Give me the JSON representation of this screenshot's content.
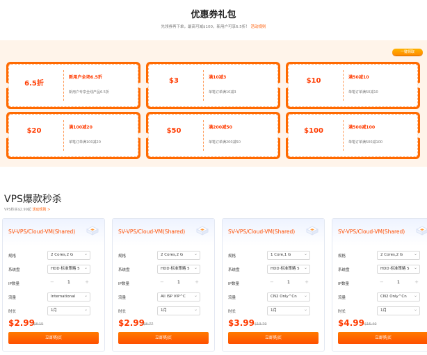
{
  "hero": {
    "title": "优惠券礼包",
    "subtitle": "先领券再下单，最高可减$100，新用户可享6.5折！",
    "rules_link": "活动规则"
  },
  "coupon_area": {
    "pill_label": "一键领取",
    "coupons": [
      {
        "amount": "6.5折",
        "title": "新用户全场6.5折",
        "desc": "新用户专享全线产品6.5折"
      },
      {
        "amount": "$3",
        "title": "满10减3",
        "desc": "单笔订单满10减3"
      },
      {
        "amount": "$10",
        "title": "满50减10",
        "desc": "单笔订单满50减10"
      },
      {
        "amount": "$20",
        "title": "满100减20",
        "desc": "单笔订单满100减20"
      },
      {
        "amount": "$50",
        "title": "满200减50",
        "desc": "单笔订单满200减50"
      },
      {
        "amount": "$100",
        "title": "满500减100",
        "desc": "单笔订单满500减100"
      }
    ]
  },
  "vps_section": {
    "title": "VPS爆款秒杀",
    "subtitle": "VPS秒杀$2.99起",
    "rules_link": "活动规则 >"
  },
  "cards": [
    {
      "name": "SV-VPS/Cloud-VM(Shared)",
      "spec_label": "规格",
      "spec": "2 Cores,2 G",
      "disk_label": "系统盘",
      "disk": "HDD 标准策略 5",
      "ip_label": "IP数量",
      "ip_count": "1",
      "traffic_label": "流量",
      "traffic": "International",
      "duration_label": "时长",
      "duration": "1月",
      "price": "$2.99",
      "old_price": "$8.15",
      "buy": "立即购买"
    },
    {
      "name": "SV-VPS/Cloud-VM(Shared)",
      "spec_label": "规格",
      "spec": "2 Cores,2 G",
      "disk_label": "系统盘",
      "disk": "HDD 标准策略 5",
      "ip_label": "IP数量",
      "ip_count": "1",
      "traffic_label": "流量",
      "traffic": "All ISP VIP^C",
      "duration_label": "时长",
      "duration": "1月",
      "price": "$2.99",
      "old_price": "$8.77",
      "buy": "立即购买"
    },
    {
      "name": "SV-VPS/Cloud-VM(Shared)",
      "spec_label": "规格",
      "spec": "1 Core,1 G",
      "disk_label": "系统盘",
      "disk": "HDD 标准策略 5",
      "ip_label": "IP数量",
      "ip_count": "1",
      "traffic_label": "流量",
      "traffic": "CN2 Only^Cn",
      "duration_label": "时长",
      "duration": "1月",
      "price": "$3.99",
      "old_price": "$13.70",
      "buy": "立即购买"
    },
    {
      "name": "SV-VPS/Cloud-VM(Shared)",
      "spec_label": "规格",
      "spec": "2 Cores,2 G",
      "disk_label": "系统盘",
      "disk": "HDD 标准策略 5",
      "ip_label": "IP数量",
      "ip_count": "1",
      "traffic_label": "流量",
      "traffic": "CN2 Only^Cn",
      "duration_label": "时长",
      "duration": "1月",
      "price": "$4.99",
      "old_price": "$15.40",
      "buy": "立即购买"
    }
  ]
}
